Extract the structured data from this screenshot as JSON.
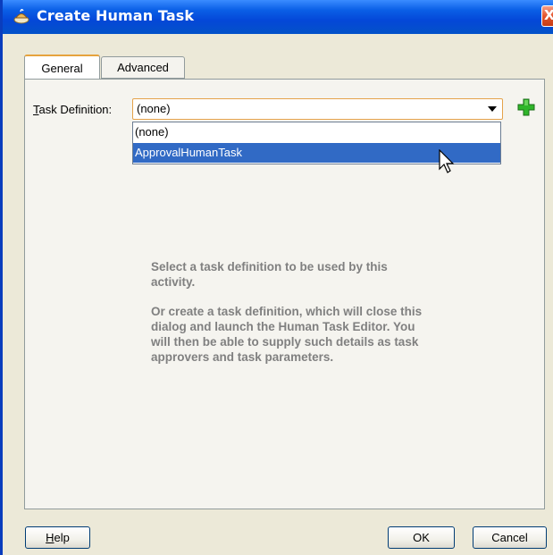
{
  "window": {
    "title": "Create Human Task",
    "close_glyph": "X"
  },
  "tabs": [
    {
      "label": "General",
      "selected": true
    },
    {
      "label": "Advanced",
      "selected": false
    }
  ],
  "form": {
    "task_definition_label_mnemonic": "T",
    "task_definition_label_rest": "ask Definition:",
    "task_definition_value": "(none)",
    "add_icon": "plus-icon",
    "dropdown_options": [
      "(none)",
      "ApprovalHumanTask"
    ],
    "highlighted_option": "ApprovalHumanTask"
  },
  "info": {
    "paragraph1": "Select a task definition to be used by this activity.",
    "paragraph2": "Or create a task definition, which will close this dialog and launch the Human Task Editor. You will then be able to supply such details as task approvers and task parameters."
  },
  "buttons": {
    "help_mnemonic": "H",
    "help_rest": "elp",
    "ok": "OK",
    "cancel": "Cancel"
  },
  "colors": {
    "titlebar": "#0447d8",
    "selection": "#316ac5",
    "add_icon": "#2fb52a",
    "focus_border": "#e5a34b"
  }
}
